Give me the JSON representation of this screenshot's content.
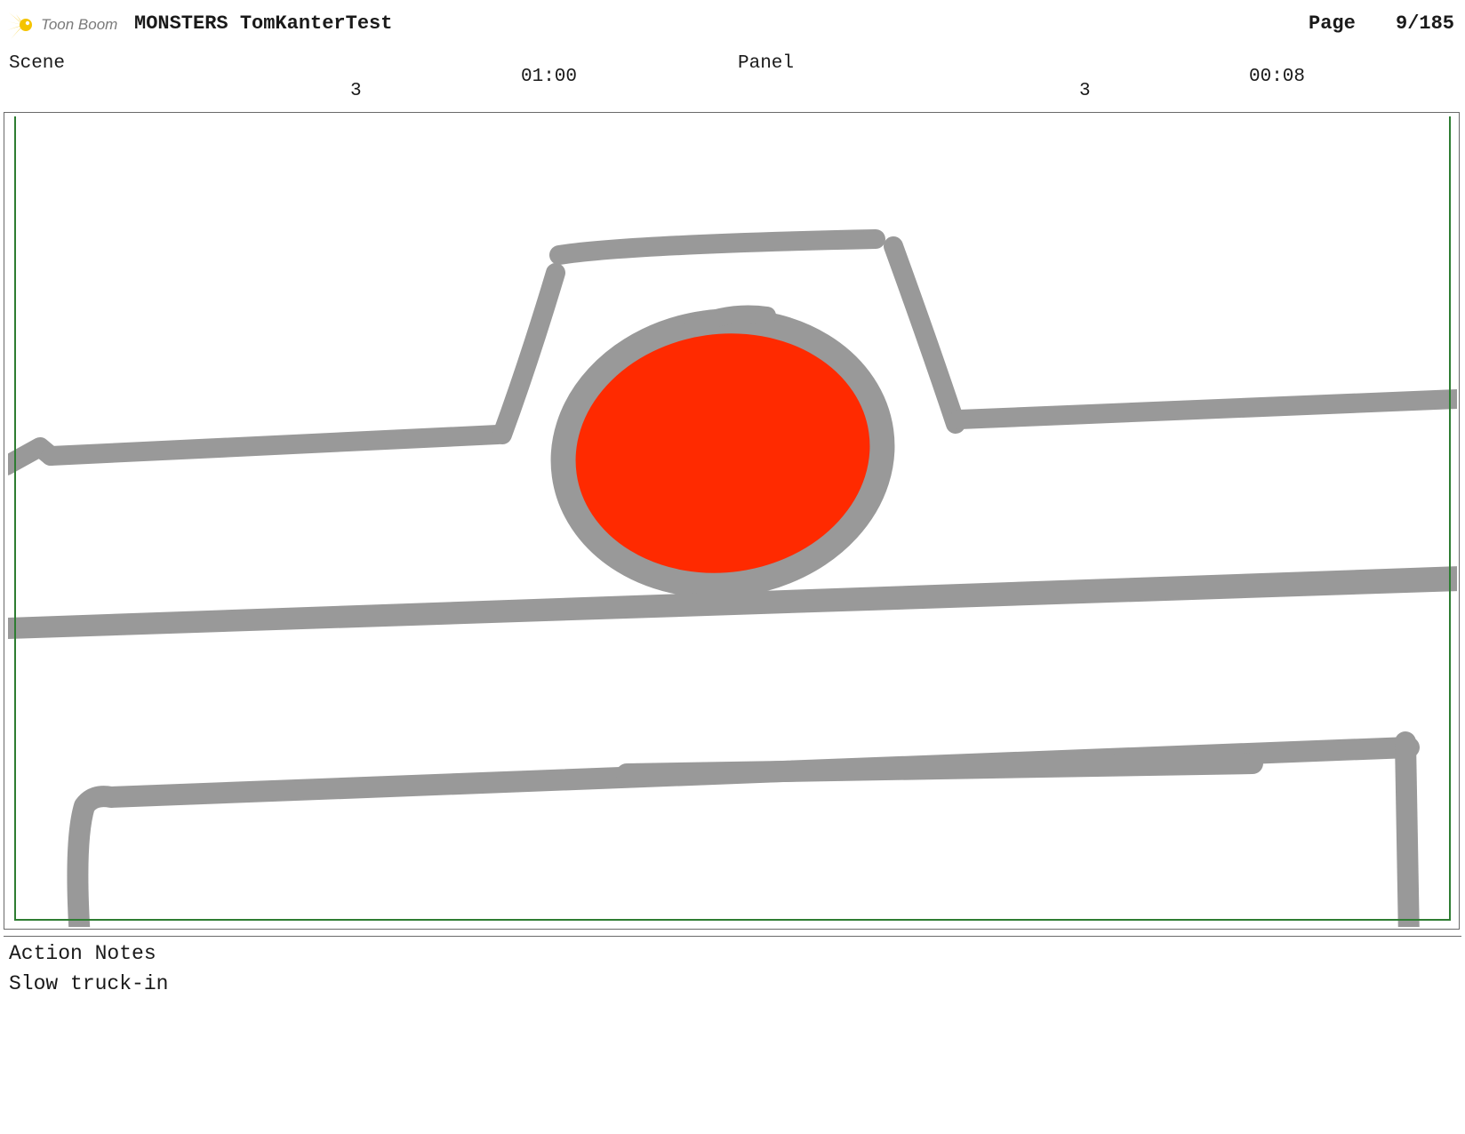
{
  "header": {
    "brand": "Toon Boom",
    "project_title": "MONSTERS TomKanterTest",
    "page_label": "Page",
    "page_number": "9/185"
  },
  "scene": {
    "label": "Scene",
    "value": "3",
    "duration": "01:00"
  },
  "panel": {
    "label": "Panel",
    "value": "3",
    "duration": "00:08"
  },
  "notes": {
    "title": "Action Notes",
    "text": "Slow truck-in"
  },
  "colors": {
    "sketch_stroke": "#999999",
    "fill_red": "#ff2a00",
    "safe_frame": "#2e7d32",
    "logo_yellow": "#f5c400"
  }
}
